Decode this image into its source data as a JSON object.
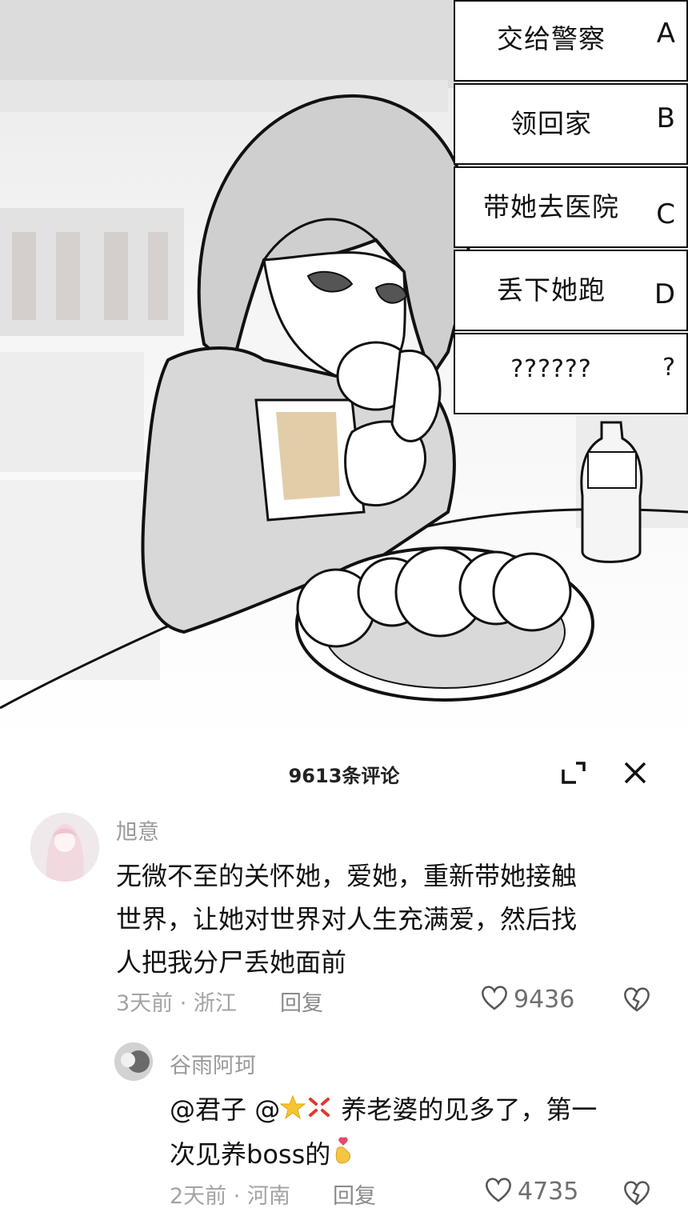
{
  "options": [
    {
      "text": "交给警察",
      "letter": "A"
    },
    {
      "text": "领回家",
      "letter": "B"
    },
    {
      "text": "带她去医院",
      "letter": "C"
    },
    {
      "text": "丢下她跑",
      "letter": "D"
    },
    {
      "text": "??????",
      "letter": "?"
    }
  ],
  "comments_sheet": {
    "title": "9613条评论",
    "icons": [
      "expand-icon",
      "close-icon"
    ]
  },
  "comments": [
    {
      "user": "旭意",
      "text_lines": [
        "无微不至的关怀她，爱她，重新带她接触",
        "世界，让她对世界对人生充满爱，然后找",
        "人把我分尸丢她面前"
      ],
      "meta": "3天前 · 浙江",
      "reply_label": "回复",
      "likes": "9436",
      "icons": [
        "heart-icon",
        "broken-heart-icon"
      ]
    },
    {
      "user": "谷雨阿珂",
      "mention_1": "@君子",
      "mention_2": "@",
      "text_after_emoji": "养老婆的见多了，第一",
      "text_line_2": "次见养boss的",
      "emojis": [
        "star-emoji",
        "anger-emoji",
        "finger-heart-emoji"
      ],
      "meta": "2天前 · 河南",
      "reply_label": "回复",
      "likes": "4735",
      "icons": [
        "heart-icon",
        "broken-heart-icon"
      ]
    }
  ],
  "colors": {
    "sheet_bg": "#ffffff",
    "muted_text": "#a3a3a3",
    "option_border": "#111111"
  }
}
